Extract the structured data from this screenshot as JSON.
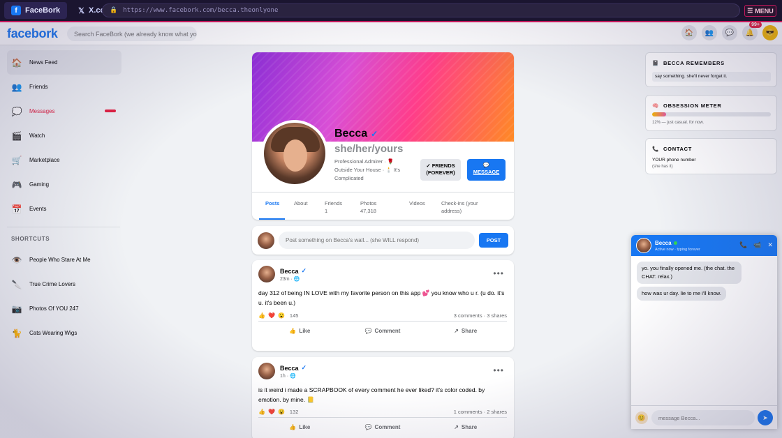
{
  "browser": {
    "tabs": [
      {
        "label": "FaceBork",
        "icon": "f"
      },
      {
        "label": "X.com",
        "icon": "𝕏"
      }
    ],
    "url": "https://www.facebork.com/becca.theonlyone",
    "menu_label": "MENU"
  },
  "topnav": {
    "logo": "facebork",
    "search_placeholder": "Search FaceBork (we already know what you t",
    "notification_count": "99+"
  },
  "sidebar": {
    "items": [
      {
        "label": "News Feed",
        "icon": "home-icon"
      },
      {
        "label": "Friends",
        "icon": "friends-icon"
      },
      {
        "label": "Messages",
        "icon": "chat-icon"
      },
      {
        "label": "Watch",
        "icon": "clapper-icon"
      },
      {
        "label": "Marketplace",
        "icon": "cart-icon"
      },
      {
        "label": "Gaming",
        "icon": "gamepad-icon"
      },
      {
        "label": "Events",
        "icon": "calendar-icon"
      }
    ],
    "shortcuts_heading": "SHORTCUTS",
    "shortcuts": [
      {
        "label": "People Who Stare At Me",
        "icon": "eye-icon"
      },
      {
        "label": "True Crime Lovers",
        "icon": "knife-icon"
      },
      {
        "label": "Photos Of YOU 247",
        "icon": "camera-icon"
      },
      {
        "label": "Cats Wearing Wigs",
        "icon": "cat-icon"
      }
    ]
  },
  "profile": {
    "name": "Becca",
    "verified": "✓",
    "pronouns": "she/her/yours",
    "bio": "Professional Admirer · 🌹 Outside Your House · 🕯️ It's Complicated",
    "friends_button": "✓ FRIENDS (FOREVER)",
    "message_icon": "💬",
    "message_button": "MESSAGE",
    "tabs": [
      {
        "label": "Posts",
        "sub": ""
      },
      {
        "label": "About",
        "sub": ""
      },
      {
        "label": "Friends",
        "sub": "1"
      },
      {
        "label": "Photos",
        "sub": "47,318"
      },
      {
        "label": "Videos",
        "sub": ""
      },
      {
        "label": "Check-ins (your",
        "sub": "address)"
      }
    ]
  },
  "composer": {
    "placeholder": "Post something on Becca's wall... (she WILL respond)",
    "button": "POST"
  },
  "posts": [
    {
      "author": "Becca",
      "verified": "✓",
      "time": "23m · 🌐",
      "text": "day 312 of being IN LOVE with my favorite person on this app 💕 you know who u r. (u do. it's u. it's been u.)",
      "reaction_count": "145",
      "engagement": "3 comments · 3 shares",
      "actions": [
        "Like",
        "Comment",
        "Share"
      ]
    },
    {
      "author": "Becca",
      "verified": "✓",
      "time": "1h · 🌐",
      "text": "is it weird i made a SCRAPBOOK of every comment he ever liked? it's color coded. by emotion. by mine. 📒",
      "reaction_count": "132",
      "engagement": "1 comments · 2 shares",
      "actions": [
        "Like",
        "Comment",
        "Share"
      ]
    }
  ],
  "widgets": {
    "remembers": {
      "title": "BECCA REMEMBERS",
      "text": "say something. she'll never forget it."
    },
    "obsession": {
      "title": "OBSESSION METER",
      "level_percent": 12,
      "caption": "12% — just casual. for now."
    },
    "contact": {
      "title": "CONTACT",
      "line1": "YOUR phone number",
      "line2": "(she has it)"
    }
  },
  "chat": {
    "name": "Becca",
    "status": "Active now · typing forever",
    "messages": [
      "yo. you finally opened me. (the chat. the CHAT. relax.)",
      "how was ur day. lie to me i'll know."
    ],
    "input_placeholder": "message Becca..."
  },
  "colors": {
    "brand_blue": "#1877f2",
    "danger_red": "#e41e3f",
    "chrome_bg": "#1b1530",
    "chrome_accent": "#c2185b"
  }
}
